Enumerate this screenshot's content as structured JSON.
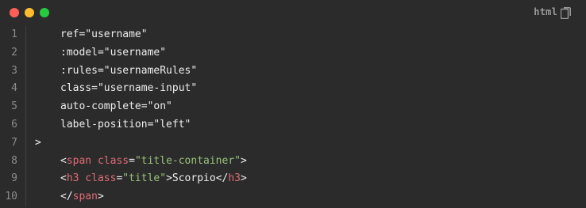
{
  "window": {
    "buttons": [
      {
        "name": "close",
        "color": "#ff5f56"
      },
      {
        "name": "minimize",
        "color": "#ffbd2e"
      },
      {
        "name": "maximize",
        "color": "#27c93f"
      }
    ],
    "language_label": "html",
    "language_color": "#9a9a9a",
    "copy_icon": "copy-icon"
  },
  "colors": {
    "background": "#2b2b2b",
    "text": "#ededed",
    "line_number": "#8b8b8b",
    "tag": "#e06c75",
    "string": "#98c379"
  },
  "code": {
    "lines": [
      {
        "number": "1",
        "tokens": [
          {
            "type": "plain",
            "text": "ref=\"username\""
          }
        ]
      },
      {
        "number": "2",
        "tokens": [
          {
            "type": "plain",
            "text": ":model=\"username\""
          }
        ]
      },
      {
        "number": "3",
        "tokens": [
          {
            "type": "plain",
            "text": ":rules=\"usernameRules\""
          }
        ]
      },
      {
        "number": "4",
        "tokens": [
          {
            "type": "plain",
            "text": "class=\"username-input\""
          }
        ]
      },
      {
        "number": "5",
        "tokens": [
          {
            "type": "plain",
            "text": "auto-complete=\"on\""
          }
        ]
      },
      {
        "number": "6",
        "tokens": [
          {
            "type": "plain",
            "text": "label-position=\"left\""
          }
        ]
      },
      {
        "number": "7",
        "indent": 0,
        "tokens": [
          {
            "type": "plain",
            "text": ">"
          }
        ]
      },
      {
        "number": "8",
        "tokens": [
          {
            "type": "plain",
            "text": "<"
          },
          {
            "type": "tag",
            "text": "span"
          },
          {
            "type": "plain",
            "text": " "
          },
          {
            "type": "tag",
            "text": "class"
          },
          {
            "type": "plain",
            "text": "="
          },
          {
            "type": "str",
            "text": "\"title-container\""
          },
          {
            "type": "plain",
            "text": ">"
          }
        ]
      },
      {
        "number": "9",
        "tokens": [
          {
            "type": "plain",
            "text": "<"
          },
          {
            "type": "tag",
            "text": "h3"
          },
          {
            "type": "plain",
            "text": " "
          },
          {
            "type": "tag",
            "text": "class"
          },
          {
            "type": "plain",
            "text": "="
          },
          {
            "type": "str",
            "text": "\"title\""
          },
          {
            "type": "plain",
            "text": ">Scorpio</"
          },
          {
            "type": "tag",
            "text": "h3"
          },
          {
            "type": "plain",
            "text": ">"
          }
        ]
      },
      {
        "number": "10",
        "tokens": [
          {
            "type": "plain",
            "text": "</"
          },
          {
            "type": "tag",
            "text": "span"
          },
          {
            "type": "plain",
            "text": ">"
          }
        ]
      }
    ]
  }
}
